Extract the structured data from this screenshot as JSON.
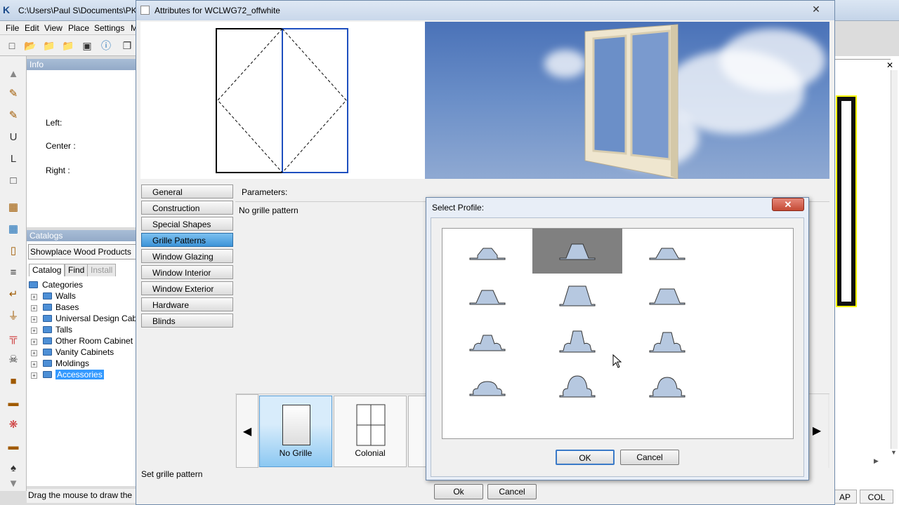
{
  "app": {
    "title": "C:\\Users\\Paul S\\Documents\\PK",
    "menu": [
      "File",
      "Edit",
      "View",
      "Place",
      "Settings",
      "M"
    ],
    "info": {
      "header": "Info",
      "left_label": "Left:",
      "center_label": "Center :",
      "right_label": "Right :"
    },
    "catalogs": {
      "header": "Catalogs",
      "selected": "Showplace Wood Products",
      "tabs": [
        "Catalog",
        "Find",
        "Install"
      ],
      "root": "Categories",
      "items": [
        "Walls",
        "Bases",
        "Universal Design Cabi",
        "Talls",
        "Other Room Cabinet",
        "Vanity Cabinets",
        "Moldings",
        "Accessories"
      ],
      "selected_item": "Accessories"
    },
    "status": "Drag the mouse to draw the",
    "bottom_right": [
      "AP",
      "COL"
    ]
  },
  "attributes": {
    "title": "Attributes for WCLWG72_offwhite",
    "tabs": [
      "General",
      "Construction",
      "Special Shapes",
      "Grille Patterns",
      "Window Glazing",
      "Window Interior",
      "Window Exterior",
      "Hardware",
      "Blinds"
    ],
    "selected_tab": "Grille Patterns",
    "params_label": "Parameters:",
    "current_pattern": "No grille pattern",
    "patterns": [
      "No Grille",
      "Colonial"
    ],
    "selected_pattern": "No Grille",
    "status": "Set grille pattern",
    "ok_label": "Ok",
    "cancel_label": "Cancel"
  },
  "dialog": {
    "title": "Select Profile:",
    "close_label": "x",
    "ok_label": "OK",
    "cancel_label": "Cancel",
    "profiles": [
      "profile-1",
      "profile-2",
      "profile-3",
      "profile-4",
      "profile-5",
      "profile-6",
      "profile-7",
      "profile-8",
      "profile-9",
      "profile-10",
      "profile-11",
      "profile-12"
    ],
    "selected_profile": "profile-2"
  },
  "colors": {
    "profile_fill": "#b6c8e0",
    "selection": "#808080",
    "tab_selected": "#3d94d8",
    "sky": "#4a72b8"
  }
}
